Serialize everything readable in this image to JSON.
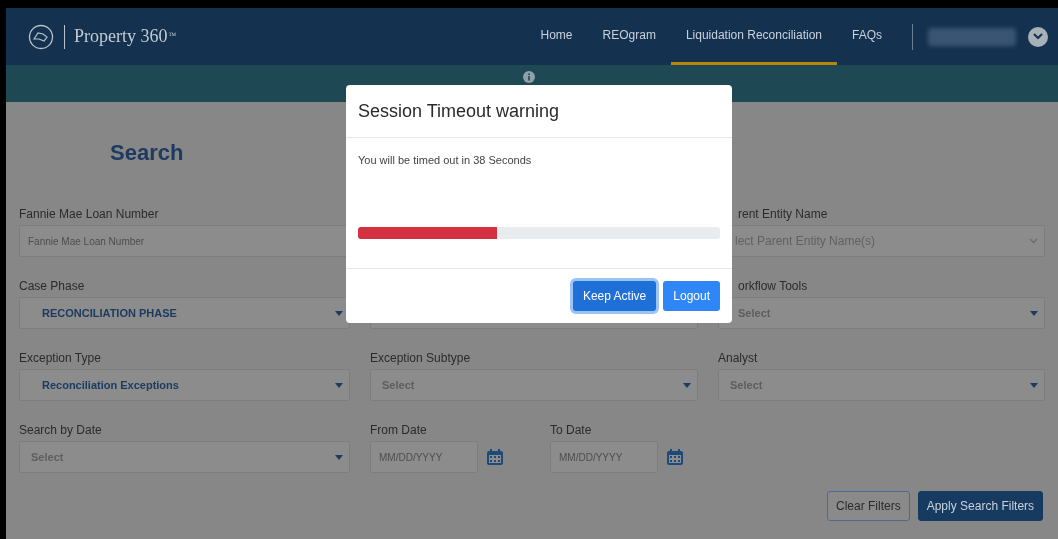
{
  "header": {
    "brand": "Property 360",
    "brand_mark": "™",
    "nav": [
      {
        "label": "Home",
        "selected": false
      },
      {
        "label": "REOgram",
        "selected": false
      },
      {
        "label": "Liquidation Reconciliation",
        "selected": true
      },
      {
        "label": "FAQs",
        "selected": false
      }
    ]
  },
  "page": {
    "title": "Search"
  },
  "filters": [
    {
      "fields": [
        {
          "kind": "text",
          "label": "Fannie Mae Loan Number",
          "placeholder": "Fannie Mae Loan Number"
        },
        {
          "kind": "multiselect",
          "label": "rent Entity Name",
          "placeholder": "lect Parent Entity Name(s)"
        }
      ]
    },
    {
      "fields": [
        {
          "kind": "select",
          "label": "Case Phase",
          "value": "RECONCILIATION PHASE"
        },
        {
          "kind": "select"
        },
        {
          "kind": "select",
          "label": "orkflow Tools",
          "placeholder": "Select"
        }
      ]
    },
    {
      "fields": [
        {
          "kind": "select",
          "label": "Exception Type",
          "value": "Reconciliation Exceptions"
        },
        {
          "kind": "select",
          "label": "Exception Subtype",
          "placeholder": "Select"
        },
        {
          "kind": "select",
          "label": "Analyst",
          "placeholder": "Select"
        }
      ]
    },
    {
      "fields": [
        {
          "kind": "select",
          "label": "Search by Date",
          "placeholder": "Select"
        },
        {
          "kind": "date",
          "label": "From Date",
          "placeholder": "MM/DD/YYYY"
        },
        {
          "kind": "date",
          "label": "To Date",
          "placeholder": "MM/DD/YYYY"
        }
      ]
    }
  ],
  "actions": [
    {
      "label": "Clear Filters",
      "kind": "secondary"
    },
    {
      "label": "Apply Search Filters",
      "kind": "primary"
    }
  ],
  "dialog": {
    "title": "Session Timeout warning",
    "message": "You will be timed out in 38 Seconds",
    "progress": {
      "level": 0.385
    },
    "buttons": [
      {
        "label": "Keep Active",
        "focused": true
      },
      {
        "label": "Logout",
        "focused": false
      }
    ]
  }
}
